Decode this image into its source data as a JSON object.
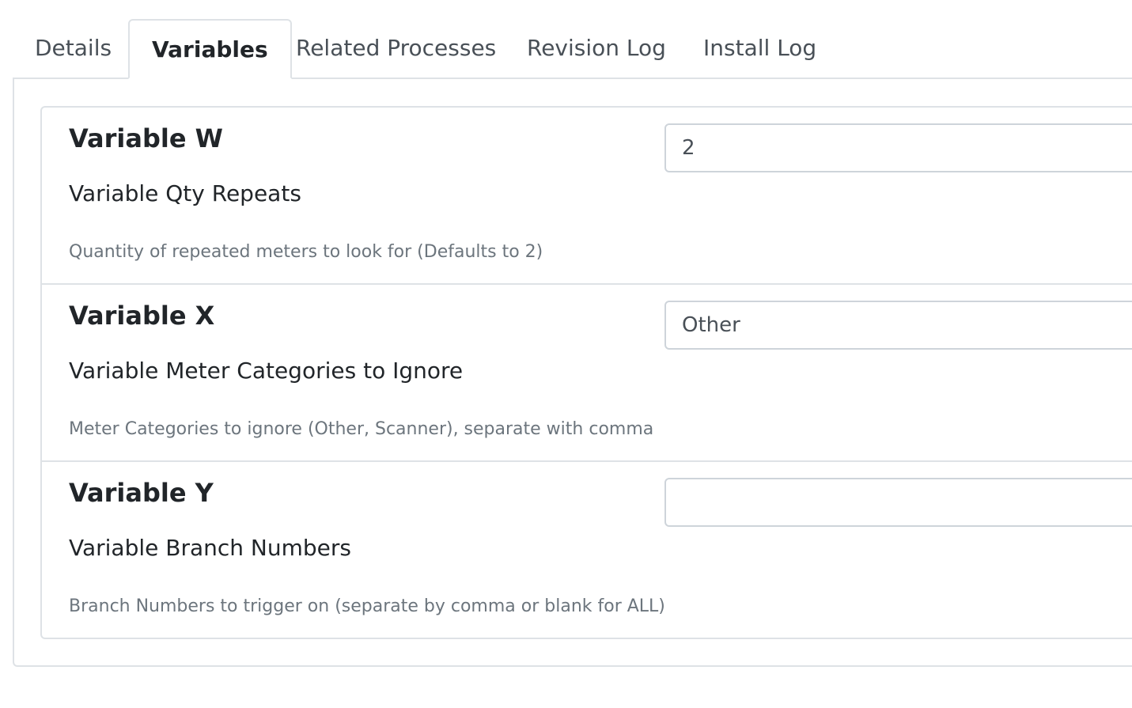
{
  "tabs": [
    {
      "label": "Details",
      "active": false
    },
    {
      "label": "Variables",
      "active": true
    },
    {
      "label": "Related Processes",
      "active": false
    },
    {
      "label": "Revision Log",
      "active": false
    },
    {
      "label": "Install Log",
      "active": false
    }
  ],
  "variables": [
    {
      "title": "Variable W",
      "label": "Variable Qty Repeats",
      "help": "Quantity of repeated meters to look for (Defaults to 2)",
      "value": "2"
    },
    {
      "title": "Variable X",
      "label": "Variable Meter Categories to Ignore",
      "help": "Meter Categories to ignore (Other, Scanner), separate with comma",
      "value": "Other"
    },
    {
      "title": "Variable Y",
      "label": "Variable Branch Numbers",
      "help": "Branch Numbers to trigger on (separate by comma or blank for ALL)",
      "value": ""
    }
  ]
}
